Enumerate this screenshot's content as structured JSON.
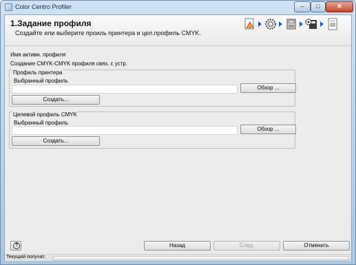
{
  "window": {
    "title": "Color Centro Profiler",
    "minimize_glyph": "–",
    "maximize_glyph": "□",
    "close_glyph": "✕"
  },
  "header": {
    "title": "1.Задание профиля",
    "subtitle": "Создайте или выберите проиль принтера и цел.профиль CMYK.",
    "steps": [
      "profile-setup-icon",
      "gear-icon",
      "printer-icon",
      "printer-settings-icon",
      "document-icon"
    ]
  },
  "main": {
    "active_profile_label": "Имя активн. профиля",
    "active_profile_value": "Создание CMYK-CMYK профиля связ. с устр.",
    "printer_profile": {
      "group_title": "Профиль принтера",
      "selected_label": "Выбранный профиль",
      "selected_value": "",
      "browse_label": "Обзор ...",
      "create_label": "Создать..."
    },
    "target_profile": {
      "group_title": "Целевой профиль CMYK",
      "selected_label": "Выбранный профиль",
      "selected_value": "",
      "browse_label": "Обзор ...",
      "create_label": "Создать..."
    }
  },
  "footer": {
    "help_glyph": "?",
    "back_label": "Назад",
    "next_label": "След.",
    "cancel_label": "Отменить"
  },
  "status": {
    "text": "Текущий получат.",
    "progress": 0
  },
  "colors": {
    "step_arrow": "#1f5fbf",
    "accent_green": "#4aa84a"
  }
}
